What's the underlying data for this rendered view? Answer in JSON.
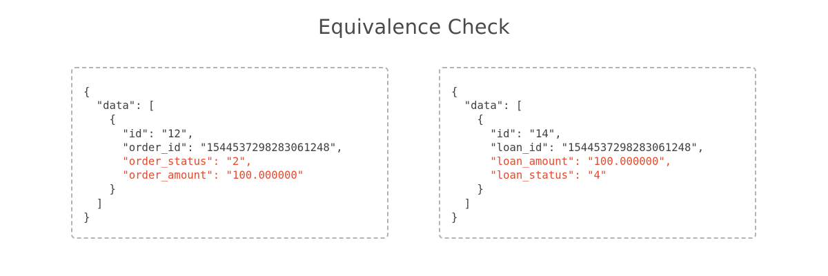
{
  "title": "Equivalence Check",
  "colors": {
    "text": "#3f3f3f",
    "highlight": "#e44a2e",
    "border": "#b3b3b3"
  },
  "panels": [
    {
      "lines": [
        {
          "text": "{",
          "highlight": false
        },
        {
          "text": "  \"data\": [",
          "highlight": false
        },
        {
          "text": "    {",
          "highlight": false
        },
        {
          "text": "      \"id\": \"12\",",
          "highlight": false
        },
        {
          "text": "      \"order_id\": \"1544537298283061248\",",
          "highlight": false
        },
        {
          "text": "      \"order_status\": \"2\",",
          "highlight": true
        },
        {
          "text": "      \"order_amount\": \"100.000000\"",
          "highlight": true
        },
        {
          "text": "    }",
          "highlight": false
        },
        {
          "text": "  ]",
          "highlight": false
        },
        {
          "text": "}",
          "highlight": false
        }
      ]
    },
    {
      "lines": [
        {
          "text": "{",
          "highlight": false
        },
        {
          "text": "  \"data\": [",
          "highlight": false
        },
        {
          "text": "    {",
          "highlight": false
        },
        {
          "text": "      \"id\": \"14\",",
          "highlight": false
        },
        {
          "text": "      \"loan_id\": \"1544537298283061248\",",
          "highlight": false
        },
        {
          "text": "      \"loan_amount\": \"100.000000\",",
          "highlight": true
        },
        {
          "text": "      \"loan_status\": \"4\"",
          "highlight": true
        },
        {
          "text": "    }",
          "highlight": false
        },
        {
          "text": "  ]",
          "highlight": false
        },
        {
          "text": "}",
          "highlight": false
        }
      ]
    }
  ]
}
